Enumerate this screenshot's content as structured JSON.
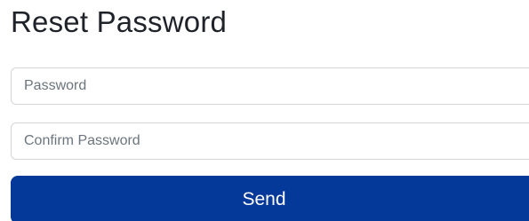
{
  "page": {
    "title": "Reset Password"
  },
  "form": {
    "password": {
      "placeholder": "Password",
      "value": ""
    },
    "confirm_password": {
      "placeholder": "Confirm Password",
      "value": ""
    },
    "submit_label": "Send"
  },
  "colors": {
    "primary_button": "#04399a",
    "button_text": "#ffffff",
    "title_text": "#1f2329",
    "input_border": "#d2d6da"
  }
}
